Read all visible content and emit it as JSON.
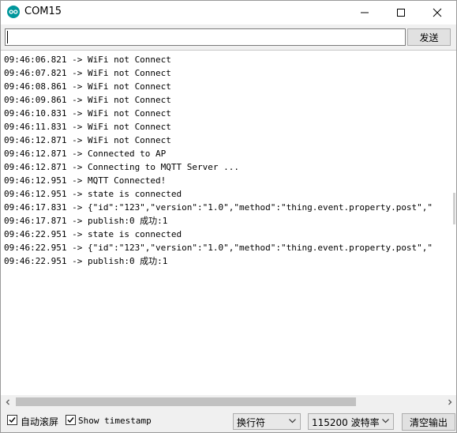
{
  "window": {
    "title": "COM15"
  },
  "send": {
    "input_value": "",
    "button_label": "发送"
  },
  "log": [
    "09:46:06.821 -> WiFi not Connect",
    "09:46:07.821 -> WiFi not Connect",
    "09:46:08.861 -> WiFi not Connect",
    "09:46:09.861 -> WiFi not Connect",
    "09:46:10.831 -> WiFi not Connect",
    "09:46:11.831 -> WiFi not Connect",
    "09:46:12.871 -> WiFi not Connect",
    "09:46:12.871 -> Connected to AP",
    "09:46:12.871 -> Connecting to MQTT Server ...",
    "09:46:12.951 -> MQTT Connected!",
    "09:46:12.951 -> state is connected",
    "09:46:17.831 -> {\"id\":\"123\",\"version\":\"1.0\",\"method\":\"thing.event.property.post\",\"",
    "09:46:17.871 -> publish:0 成功:1",
    "09:46:22.951 -> state is connected",
    "09:46:22.951 -> {\"id\":\"123\",\"version\":\"1.0\",\"method\":\"thing.event.property.post\",\"",
    "09:46:22.951 -> publish:0 成功:1"
  ],
  "bottom": {
    "autoscroll_label": "自动滚屏",
    "autoscroll_checked": true,
    "timestamp_label": "Show timestamp",
    "timestamp_checked": true,
    "line_ending": "换行符",
    "baud_rate": "115200 波特率",
    "clear_label": "清空输出"
  },
  "colors": {
    "app_icon": "#00979c",
    "chrome_bg": "#f0f0f0",
    "scroll_thumb": "#c1c1c1"
  }
}
